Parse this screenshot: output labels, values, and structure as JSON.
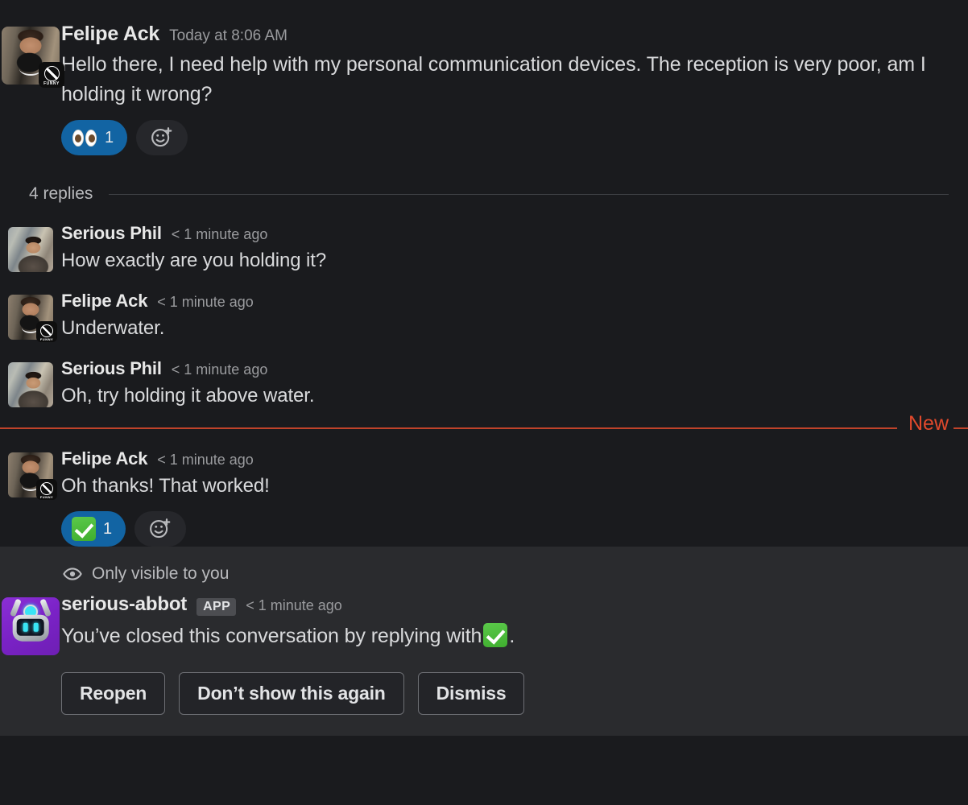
{
  "root_message": {
    "author": "Felipe Ack",
    "timestamp": "Today at 8:06 AM",
    "text": "Hello there, I need help with my personal communication devices. The reception is very poor, am I holding it wrong?",
    "reactions": [
      {
        "emoji": "eyes",
        "count": "1",
        "active": true
      }
    ],
    "add_reaction_icon": "add-reaction-icon"
  },
  "thread": {
    "replies_label": "4 replies",
    "new_divider_label": "New",
    "new_divider_color": "#e0492c",
    "replies": [
      {
        "author": "Serious Phil",
        "timestamp": "< 1 minute ago",
        "text": "How exactly are you holding it?",
        "avatar": "phil"
      },
      {
        "author": "Felipe Ack",
        "timestamp": "< 1 minute ago",
        "text": "Underwater.",
        "avatar": "felipe"
      },
      {
        "author": "Serious Phil",
        "timestamp": "< 1 minute ago",
        "text": "Oh, try holding it above water.",
        "avatar": "phil"
      },
      {
        "author": "Felipe Ack",
        "timestamp": "< 1 minute ago",
        "text": "Oh thanks! That worked!",
        "avatar": "felipe"
      }
    ],
    "last_reply_reactions": [
      {
        "emoji": "white_check_mark",
        "count": "1",
        "active": true
      }
    ]
  },
  "ephemeral": {
    "visibility_label": "Only visible to you",
    "visibility_icon": "eye-icon",
    "author": "serious-abbot",
    "app_badge": "APP",
    "timestamp": "< 1 minute ago",
    "text_before_emoji": "You’ve closed this conversation by replying with",
    "inline_emoji": "white_check_mark",
    "text_after_emoji": ".",
    "buttons": [
      {
        "label": "Reopen",
        "name": "reopen-button"
      },
      {
        "label": "Don’t show this again",
        "name": "dont-show-again-button"
      },
      {
        "label": "Dismiss",
        "name": "dismiss-button"
      }
    ]
  },
  "colors": {
    "background": "#1a1b1e",
    "ephemeral_background": "#2a2b2e",
    "reaction_active": "#1264a3",
    "new_marker": "#e0492c",
    "text_primary": "#d9dadc",
    "text_muted": "#9a9b9e"
  }
}
